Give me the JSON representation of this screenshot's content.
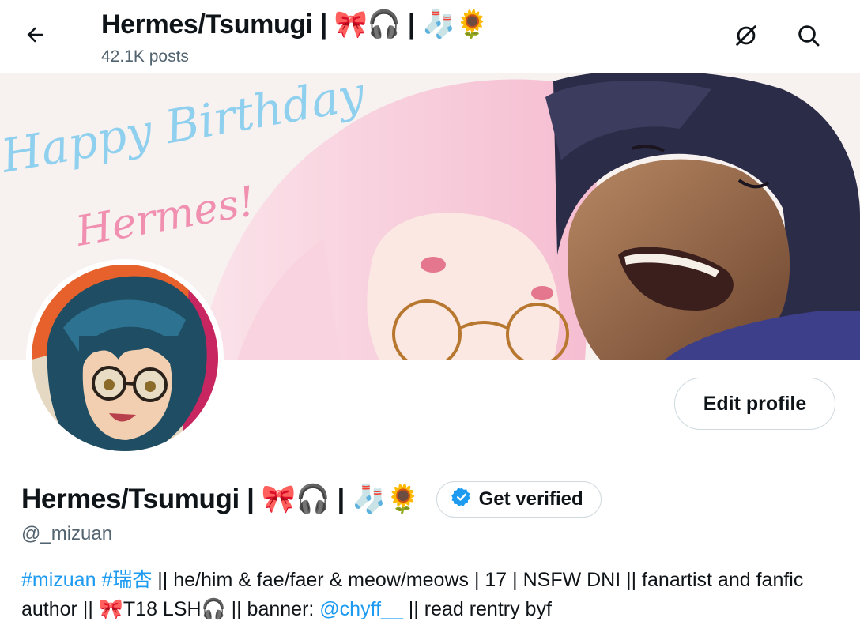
{
  "header": {
    "title": "Hermes/Tsumugi | 🎀🎧 | 🧦🌻",
    "post_count": "42.1K posts",
    "back_icon": "arrow-left-icon",
    "grok_icon": "slash-circle-icon",
    "search_icon": "search-icon"
  },
  "banner": {
    "greeting": "Happy Birthday",
    "name_line": "Hermes!"
  },
  "profile": {
    "edit_label": "Edit profile",
    "display_name": "Hermes/Tsumugi | 🎀🎧 | 🧦🌻",
    "verify_label": "Get verified",
    "handle": "@_mizuan"
  },
  "bio": {
    "tag1": "#mizuan",
    "tag2": "#瑞杏",
    "text1": " || he/him & fae/faer & meow/meows | 17 | NSFW DNI || fanartist and fanfic author || 🎀T18 LSH🎧 || banner: ",
    "mention": "@chyff__",
    "text2": " || read rentry byf"
  },
  "colors": {
    "accent": "#1d9bf0",
    "text": "#0f1419",
    "muted": "#536471",
    "border": "#cfd9de"
  }
}
